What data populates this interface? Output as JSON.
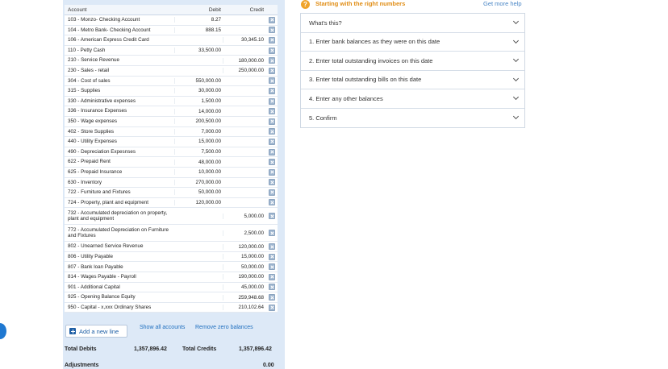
{
  "grid": {
    "header": {
      "account": "Account",
      "debit": "Debit",
      "credit": "Credit"
    },
    "rows": [
      {
        "account": "103 - Monzo- Checking Account",
        "debit": "8.27",
        "credit": ""
      },
      {
        "account": "104 - Metro Bank- Checking Account",
        "debit": "888.15",
        "credit": ""
      },
      {
        "account": "106 - American Express Credit Card",
        "debit": "",
        "credit": "30,345.10"
      },
      {
        "account": "110 - Petty Cash",
        "debit": "33,500.00",
        "credit": ""
      },
      {
        "account": "210 - Service Revenue",
        "debit": "",
        "credit": "180,000.00"
      },
      {
        "account": "230 - Sales - retail",
        "debit": "",
        "credit": "250,000.00"
      },
      {
        "account": "304 - Cost of sales",
        "debit": "550,000.00",
        "credit": ""
      },
      {
        "account": "315 - Supplies",
        "debit": "30,000.00",
        "credit": ""
      },
      {
        "account": "330 - Administrative expenses",
        "debit": "1,500.00",
        "credit": ""
      },
      {
        "account": "336 - Insurance Expenses",
        "debit": "14,000.00",
        "credit": ""
      },
      {
        "account": "350 - Wage expenses",
        "debit": "200,500.00",
        "credit": ""
      },
      {
        "account": "402 - Store Supplies",
        "debit": "7,000.00",
        "credit": ""
      },
      {
        "account": "440 - Utility Expenses",
        "debit": "15,000.00",
        "credit": ""
      },
      {
        "account": "490 - Depreciation Expesnses",
        "debit": "7,500.00",
        "credit": ""
      },
      {
        "account": "622 - Prepaid Rent",
        "debit": "48,000.00",
        "credit": ""
      },
      {
        "account": "625 - Prepaid Insurance",
        "debit": "10,000.00",
        "credit": ""
      },
      {
        "account": "630 - Inventory",
        "debit": "270,000.00",
        "credit": ""
      },
      {
        "account": "722 - Furniture and Fixtures",
        "debit": "50,000.00",
        "credit": ""
      },
      {
        "account": "724 - Property, plant and equipment",
        "debit": "120,000.00",
        "credit": ""
      },
      {
        "account": "732 - Accumulated depreciation on property, plant and equipment",
        "debit": "",
        "credit": "5,000.00"
      },
      {
        "account": "772 - Accumulated Depreciation on Furniture and Fixtures",
        "debit": "",
        "credit": "2,500.00"
      },
      {
        "account": "802 - Unearned Service Revenue",
        "debit": "",
        "credit": "120,000.00"
      },
      {
        "account": "806 - Utility Payable",
        "debit": "",
        "credit": "15,000.00"
      },
      {
        "account": "807 - Bank loan Payable",
        "debit": "",
        "credit": "50,000.00"
      },
      {
        "account": "814 - Wages Payable - Payroll",
        "debit": "",
        "credit": "190,000.00"
      },
      {
        "account": "901 - Additional Capital",
        "debit": "",
        "credit": "45,000.00"
      },
      {
        "account": "925 - Opening Balance Equity",
        "debit": "",
        "credit": "259,948.68"
      },
      {
        "account": "950 - Capital - x,xxx Ordinary Shares",
        "debit": "",
        "credit": "210,102.64"
      }
    ]
  },
  "actions": {
    "add_line": "Add a new line",
    "show_all": "Show all accounts",
    "remove_zero": "Remove zero balances"
  },
  "totals": {
    "debits_label": "Total Debits",
    "debits_value": "1,357,896.42",
    "credits_label": "Total Credits",
    "credits_value": "1,357,896.42",
    "adjustments_label": "Adjustments",
    "adjustments_value": "0.00"
  },
  "help": {
    "badge": "?",
    "title": "Starting with the right numbers",
    "get_help": "Get more help",
    "items": [
      "What's this?",
      "1. Enter bank balances as they were on this date",
      "2. Enter total outstanding invoices on this date",
      "3. Enter total outstanding bills on this date",
      "4. Enter any other balances",
      "5. Confirm"
    ]
  },
  "colors": {
    "panel": "#dde9f7",
    "accent": "#1f6fbf",
    "help_title": "#e08c13"
  }
}
